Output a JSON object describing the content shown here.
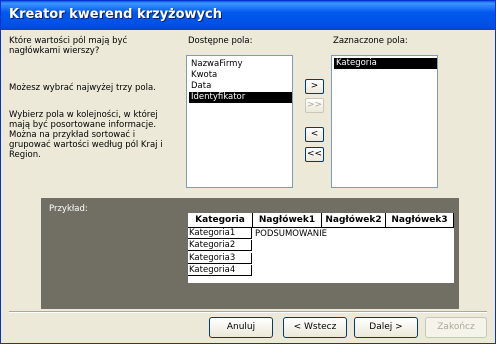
{
  "window": {
    "title": "Kreator kwerend krzyżowych"
  },
  "instructions": {
    "question": "Które wartości pól mają być nagłówkami wierszy?",
    "limit": "Możesz wybrać najwyżej trzy pola.",
    "order_line1": "Wybierz pola w kolejności, w której",
    "order_line2": "mają być posortowane informacje.",
    "order_line3": "Można na przykład sortować i",
    "order_line4": "grupować wartości według pól Kraj i",
    "order_line5": "Region."
  },
  "available": {
    "label": "Dostępne pola:",
    "items": [
      "NazwaFirmy",
      "Kwota",
      "Data",
      "Identyfikator"
    ],
    "selected_index": 3
  },
  "selected": {
    "label": "Zaznaczone pola:",
    "items": [
      "Kategoria"
    ]
  },
  "move_buttons": {
    "add_one": ">",
    "add_all": ">>",
    "remove_one": "<",
    "remove_all": "<<"
  },
  "example": {
    "label": "Przykład:",
    "headers": [
      "Kategoria",
      "Nagłówek1",
      "Nagłówek2",
      "Nagłówek3"
    ],
    "rows": [
      "Kategoria1",
      "Kategoria2",
      "Kategoria3",
      "Kategoria4"
    ],
    "summary": "PODSUMOWANIE"
  },
  "footer": {
    "cancel": "Anuluj",
    "back": "< Wstecz",
    "next": "Dalej >",
    "finish": "Zakończ"
  }
}
